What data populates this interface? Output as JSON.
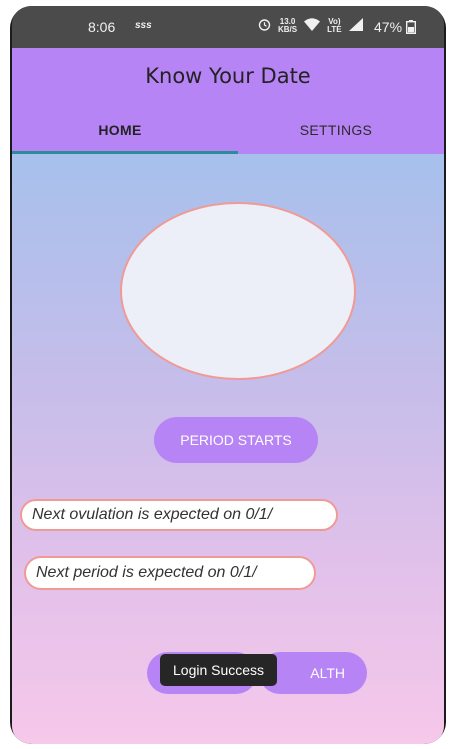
{
  "status_bar": {
    "time": "8:06",
    "extra": "sss",
    "network_top": "13.0",
    "network_bottom": "KB/S",
    "volte_top": "Vo)",
    "volte_bottom": "LTE",
    "battery": "47%",
    "icons": [
      "alarm-icon",
      "wifi-icon",
      "signal-icon",
      "battery-icon"
    ]
  },
  "app_bar": {
    "title": "Know Your Date",
    "tabs": [
      {
        "label": "HOME",
        "selected": true
      },
      {
        "label": "SETTINGS",
        "selected": false
      }
    ]
  },
  "main": {
    "period_button": "PERIOD STARTS",
    "ovulation_text": "Next ovulation is expected on 0/1/",
    "period_text": "Next period is expected on 0/1/",
    "bottom_button_right": "ALTH"
  },
  "toast": "Login Success",
  "colors": {
    "accent": "#b784f5",
    "tab_indicator": "#2e8b99",
    "chip_border": "#f09a95"
  }
}
